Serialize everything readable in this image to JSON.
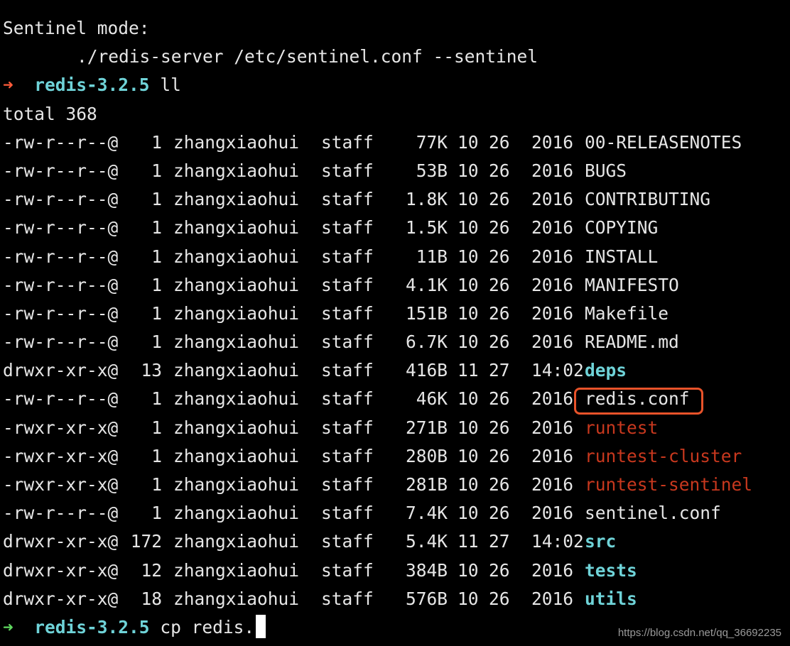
{
  "terminal": {
    "header_line": "Sentinel mode:",
    "command_line": "./redis-server /etc/sentinel.conf --sentinel",
    "prompt1": {
      "arrow": "➜",
      "cwd": "redis-3.2.5",
      "command": "ll"
    },
    "total_line": "total 368",
    "files": [
      {
        "perm": "-rw-r--r--@",
        "links": "1",
        "owner": "zhangxiaohui",
        "group": "staff",
        "size": "77K",
        "mon": "10",
        "day": "26",
        "time": "2016",
        "name": "00-RELEASENOTES",
        "kind": "plain"
      },
      {
        "perm": "-rw-r--r--@",
        "links": "1",
        "owner": "zhangxiaohui",
        "group": "staff",
        "size": "53B",
        "mon": "10",
        "day": "26",
        "time": "2016",
        "name": "BUGS",
        "kind": "plain"
      },
      {
        "perm": "-rw-r--r--@",
        "links": "1",
        "owner": "zhangxiaohui",
        "group": "staff",
        "size": "1.8K",
        "mon": "10",
        "day": "26",
        "time": "2016",
        "name": "CONTRIBUTING",
        "kind": "plain"
      },
      {
        "perm": "-rw-r--r--@",
        "links": "1",
        "owner": "zhangxiaohui",
        "group": "staff",
        "size": "1.5K",
        "mon": "10",
        "day": "26",
        "time": "2016",
        "name": "COPYING",
        "kind": "plain"
      },
      {
        "perm": "-rw-r--r--@",
        "links": "1",
        "owner": "zhangxiaohui",
        "group": "staff",
        "size": "11B",
        "mon": "10",
        "day": "26",
        "time": "2016",
        "name": "INSTALL",
        "kind": "plain"
      },
      {
        "perm": "-rw-r--r--@",
        "links": "1",
        "owner": "zhangxiaohui",
        "group": "staff",
        "size": "4.1K",
        "mon": "10",
        "day": "26",
        "time": "2016",
        "name": "MANIFESTO",
        "kind": "plain"
      },
      {
        "perm": "-rw-r--r--@",
        "links": "1",
        "owner": "zhangxiaohui",
        "group": "staff",
        "size": "151B",
        "mon": "10",
        "day": "26",
        "time": "2016",
        "name": "Makefile",
        "kind": "plain"
      },
      {
        "perm": "-rw-r--r--@",
        "links": "1",
        "owner": "zhangxiaohui",
        "group": "staff",
        "size": "6.7K",
        "mon": "10",
        "day": "26",
        "time": "2016",
        "name": "README.md",
        "kind": "plain"
      },
      {
        "perm": "drwxr-xr-x@",
        "links": "13",
        "owner": "zhangxiaohui",
        "group": "staff",
        "size": "416B",
        "mon": "11",
        "day": "27",
        "time": "14:02",
        "name": "deps",
        "kind": "dir"
      },
      {
        "perm": "-rw-r--r--@",
        "links": "1",
        "owner": "zhangxiaohui",
        "group": "staff",
        "size": "46K",
        "mon": "10",
        "day": "26",
        "time": "2016",
        "name": "redis.conf",
        "kind": "plain"
      },
      {
        "perm": "-rwxr-xr-x@",
        "links": "1",
        "owner": "zhangxiaohui",
        "group": "staff",
        "size": "271B",
        "mon": "10",
        "day": "26",
        "time": "2016",
        "name": "runtest",
        "kind": "exec"
      },
      {
        "perm": "-rwxr-xr-x@",
        "links": "1",
        "owner": "zhangxiaohui",
        "group": "staff",
        "size": "280B",
        "mon": "10",
        "day": "26",
        "time": "2016",
        "name": "runtest-cluster",
        "kind": "exec"
      },
      {
        "perm": "-rwxr-xr-x@",
        "links": "1",
        "owner": "zhangxiaohui",
        "group": "staff",
        "size": "281B",
        "mon": "10",
        "day": "26",
        "time": "2016",
        "name": "runtest-sentinel",
        "kind": "exec"
      },
      {
        "perm": "-rw-r--r--@",
        "links": "1",
        "owner": "zhangxiaohui",
        "group": "staff",
        "size": "7.4K",
        "mon": "10",
        "day": "26",
        "time": "2016",
        "name": "sentinel.conf",
        "kind": "plain"
      },
      {
        "perm": "drwxr-xr-x@",
        "links": "172",
        "owner": "zhangxiaohui",
        "group": "staff",
        "size": "5.4K",
        "mon": "11",
        "day": "27",
        "time": "14:02",
        "name": "src",
        "kind": "dir"
      },
      {
        "perm": "drwxr-xr-x@",
        "links": "12",
        "owner": "zhangxiaohui",
        "group": "staff",
        "size": "384B",
        "mon": "10",
        "day": "26",
        "time": "2016",
        "name": "tests",
        "kind": "dir"
      },
      {
        "perm": "drwxr-xr-x@",
        "links": "18",
        "owner": "zhangxiaohui",
        "group": "staff",
        "size": "576B",
        "mon": "10",
        "day": "26",
        "time": "2016",
        "name": "utils",
        "kind": "dir"
      }
    ],
    "prompt2": {
      "arrow": "➜",
      "cwd": "redis-3.2.5",
      "command": "cp redis."
    },
    "highlighted_file": "redis.conf"
  },
  "colors": {
    "background": "#000000",
    "text": "#e6e6e6",
    "directory": "#6fd3d8",
    "executable": "#c8381e",
    "prompt_fail_arrow": "#ff5b3a",
    "prompt_ok_arrow": "#5fd75f",
    "highlight_box": "#e8532a"
  },
  "watermark": "https://blog.csdn.net/qq_36692235"
}
